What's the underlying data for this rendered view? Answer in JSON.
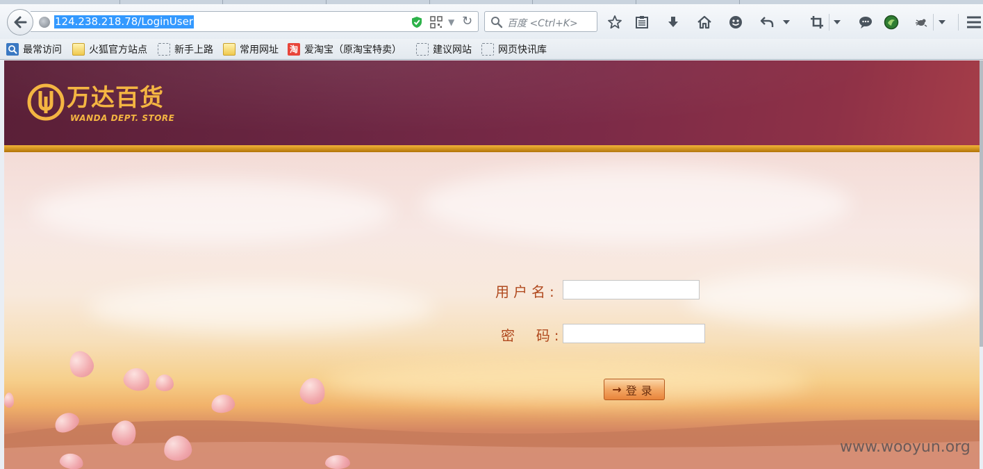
{
  "browser": {
    "url": "124.238.218.78/LoginUser",
    "search_placeholder": "百度 <Ctrl+K>",
    "bookmarks": [
      {
        "label": "最常访问",
        "icon": "search-bookmark-icon"
      },
      {
        "label": "火狐官方站点",
        "icon": "folder-icon"
      },
      {
        "label": "新手上路",
        "icon": "dashed-page-icon"
      },
      {
        "label": "常用网址",
        "icon": "folder-icon"
      },
      {
        "label": "爱淘宝（原淘宝特卖）",
        "icon": "taobao-icon"
      },
      {
        "label": "建议网站",
        "icon": "dashed-page-icon"
      },
      {
        "label": "网页快讯库",
        "icon": "dashed-page-icon"
      }
    ],
    "taobao_glyph": "淘"
  },
  "page": {
    "logo_cn": "万达百货",
    "logo_en": "WANDA DEPT. STORE",
    "form": {
      "username_label": "用户名:",
      "password_label": "密  码:",
      "username_value": "",
      "password_value": "",
      "login_label": "登录",
      "login_arrow": "→"
    },
    "watermark": "www.wooyun.org"
  },
  "colors": {
    "header": "#6b2642",
    "gold": "#f2b43a",
    "label": "#b0491e",
    "url_selection": "#3399ff"
  }
}
